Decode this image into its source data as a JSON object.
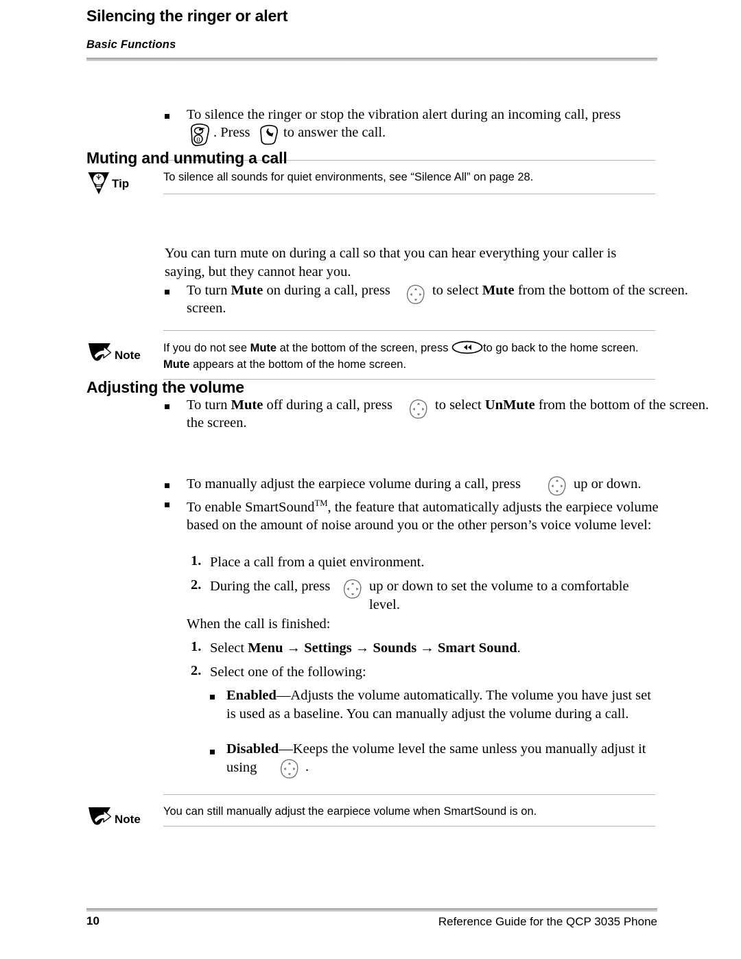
{
  "page": {
    "running_header": "Basic Functions",
    "page_number": "10",
    "footer_title": "Reference Guide for the QCP 3035 Phone"
  },
  "sections": [
    {
      "id": "silencing",
      "title": "Silencing the ringer or alert",
      "bullets": [
        {
          "text_before": "To silence the ringer or stop the vibration alert during an incoming call, press",
          "icon_1": "end-key-icon",
          "text_middle": ". Press",
          "icon_2": "send-key-icon",
          "text_after": "to answer the call."
        }
      ],
      "admonition": {
        "type": "Tip",
        "label": "Tip",
        "icon": "tip-lightbulb-icon",
        "text": "To silence all sounds for quiet environments, see “Silence All” on page 28."
      }
    },
    {
      "id": "muting",
      "title": "Muting and unmuting a call",
      "intro": "You can turn mute on during a call so that you can hear everything your caller is saying, but they cannot hear you.",
      "bullet_1": {
        "part_1": "To turn ",
        "bold_1": "Mute",
        "part_2": " on during a call, press",
        "icon": "navigation-key-icon",
        "part_3": "to select ",
        "bold_2": "Mute",
        "part_4": " from the bottom of the screen."
      },
      "admonition": {
        "type": "Note",
        "label": "Note",
        "icon": "note-arrow-icon",
        "part_1": "If you do not see ",
        "bold_1": "Mute",
        "part_2": " at the bottom of the screen, press",
        "icon_inline": "back-key-icon",
        "part_3": "to go back to the home screen. ",
        "bold_2": "Mute",
        "part_4": " appears at the bottom of the home screen."
      },
      "bullet_2": {
        "part_1": "To turn ",
        "bold_1": "Mute",
        "part_2": " off during a call, press",
        "icon": "navigation-key-icon",
        "part_3": "to select ",
        "bold_2": "UnMute",
        "part_4": " from the bottom of the screen."
      }
    },
    {
      "id": "volume",
      "title": "Adjusting the volume",
      "bullet_1": {
        "part_1": "To manually adjust the earpiece volume during a call, press",
        "icon": "navigation-key-icon",
        "part_2": "up or down."
      },
      "bullet_2": {
        "part_1": "To enable SmartSound",
        "superscript": "TM",
        "part_2": ", the feature that automatically adjusts the earpiece volume based on the amount of noise around you or the other person’s voice volume level:"
      },
      "steps_during": [
        {
          "num": "1.",
          "text": "Place a call from a quiet environment."
        },
        {
          "num": "2.",
          "part_1": "During the call, press",
          "icon": "navigation-key-icon",
          "part_2": "up or down to set the volume to a comfortable level."
        }
      ],
      "interstitial": "When the call is finished:",
      "steps_after": [
        {
          "num": "1.",
          "part_1": "Select ",
          "bold": "Menu → Settings → Sounds → Smart Sound",
          "part_2": "."
        },
        {
          "num": "2.",
          "text": "Select one of the following:"
        }
      ],
      "options": [
        {
          "bold": "Enabled",
          "text": "—Adjusts the volume automatically. The volume you have just set is used as a baseline. You can manually adjust the volume during a call."
        },
        {
          "bold": "Disabled",
          "text": "—Keeps the volume level the same unless you manually adjust it using",
          "icon": "navigation-key-icon",
          "trailing": "."
        }
      ],
      "admonition": {
        "type": "Note",
        "label": "Note",
        "icon": "note-arrow-icon",
        "text": "You can still manually adjust the earpiece volume when SmartSound is on."
      }
    }
  ]
}
